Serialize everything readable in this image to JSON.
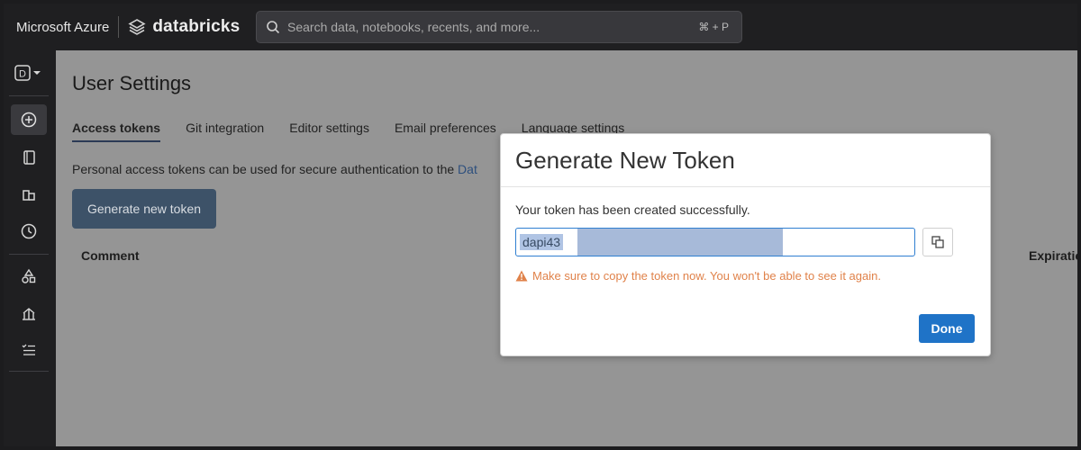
{
  "topbar": {
    "brand_microsoft": "Microsoft Azure",
    "brand_databricks": "databricks",
    "search_placeholder": "Search data, notebooks, recents, and more...",
    "search_shortcut": "⌘ + P"
  },
  "sidebar": {
    "workspace_letter": "D",
    "items": [
      {
        "icon": "plus-circle-icon"
      },
      {
        "icon": "notebook-icon"
      },
      {
        "icon": "workspace-icon"
      },
      {
        "icon": "clock-icon"
      },
      {
        "icon": "shapes-icon"
      },
      {
        "icon": "sitemap-icon"
      },
      {
        "icon": "checklist-icon"
      }
    ]
  },
  "page": {
    "title": "User Settings",
    "tabs": [
      "Access tokens",
      "Git integration",
      "Editor settings",
      "Email preferences",
      "Language settings"
    ],
    "active_tab": "Access tokens",
    "description": "Personal access tokens can be used for secure authentication to the ",
    "description_link": "Dat",
    "generate_button": "Generate new token",
    "table_headers": [
      "Comment",
      "Expiratio"
    ]
  },
  "modal": {
    "title": "Generate New Token",
    "message": "Your token has been created successfully.",
    "token_value": "dapi43",
    "warning": "Make sure to copy the token now. You won't be able to see it again.",
    "done_button": "Done"
  },
  "colors": {
    "primary_button": "#1f73c7",
    "warning": "#e0824a",
    "overlay_gray": "#959595"
  }
}
